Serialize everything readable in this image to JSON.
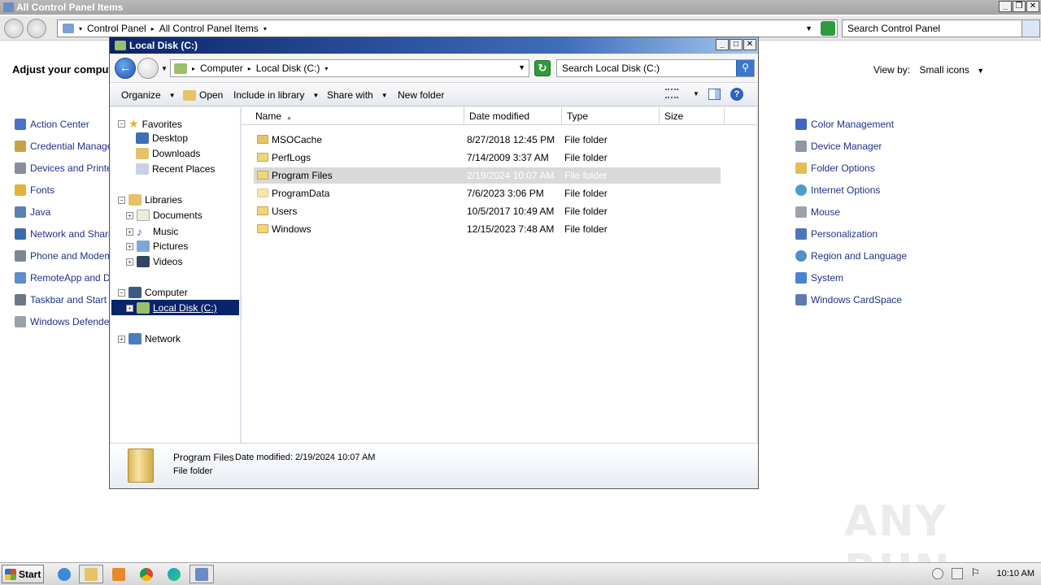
{
  "control_panel": {
    "title": "All Control Panel Items",
    "breadcrumb": [
      "Control Panel",
      "All Control Panel Items"
    ],
    "search_placeholder": "Search Control Panel",
    "heading": "Adjust your computer's settings",
    "heading_visible": "Adjust your compute",
    "view_by_label": "View by:",
    "view_by_value": "Small icons",
    "left_items": [
      "Action Center",
      "Credential Manager",
      "Devices and Printers",
      "Fonts",
      "Java",
      "Network and Sharing",
      "Phone and Modem",
      "RemoteApp and Des",
      "Taskbar and Start M",
      "Windows Defender"
    ],
    "right_items": [
      "Color Management",
      "Device Manager",
      "Folder Options",
      "Internet Options",
      "Mouse",
      "Personalization",
      "Region and Language",
      "System",
      "Windows CardSpace"
    ]
  },
  "explorer": {
    "title": "Local Disk (C:)",
    "address": [
      "Computer",
      "Local Disk (C:)"
    ],
    "search_placeholder": "Search Local Disk (C:)",
    "toolbar": {
      "organize": "Organize",
      "open": "Open",
      "include": "Include in library",
      "share": "Share with",
      "new_folder": "New folder"
    },
    "tree": {
      "favorites": "Favorites",
      "desktop": "Desktop",
      "downloads": "Downloads",
      "recent": "Recent Places",
      "libraries": "Libraries",
      "documents": "Documents",
      "music": "Music",
      "pictures": "Pictures",
      "videos": "Videos",
      "computer": "Computer",
      "local_disk": "Local Disk (C:)",
      "network": "Network"
    },
    "columns": [
      "Name",
      "Date modified",
      "Type",
      "Size"
    ],
    "files": [
      {
        "name": "MSOCache",
        "date": "8/27/2018 12:45 PM",
        "type": "File folder"
      },
      {
        "name": "PerfLogs",
        "date": "7/14/2009 3:37 AM",
        "type": "File folder"
      },
      {
        "name": "Program Files",
        "date": "2/19/2024 10:07 AM",
        "type": "File folder"
      },
      {
        "name": "ProgramData",
        "date": "7/6/2023 3:06 PM",
        "type": "File folder"
      },
      {
        "name": "Users",
        "date": "10/5/2017 10:49 AM",
        "type": "File folder"
      },
      {
        "name": "Windows",
        "date": "12/15/2023 7:48 AM",
        "type": "File folder"
      }
    ],
    "details": {
      "name": "Program Files",
      "modified": "Date modified:  2/19/2024 10:07 AM",
      "type": "File folder"
    }
  },
  "taskbar": {
    "start": "Start",
    "clock": "10:10 AM"
  },
  "watermark": "ANY RUN"
}
